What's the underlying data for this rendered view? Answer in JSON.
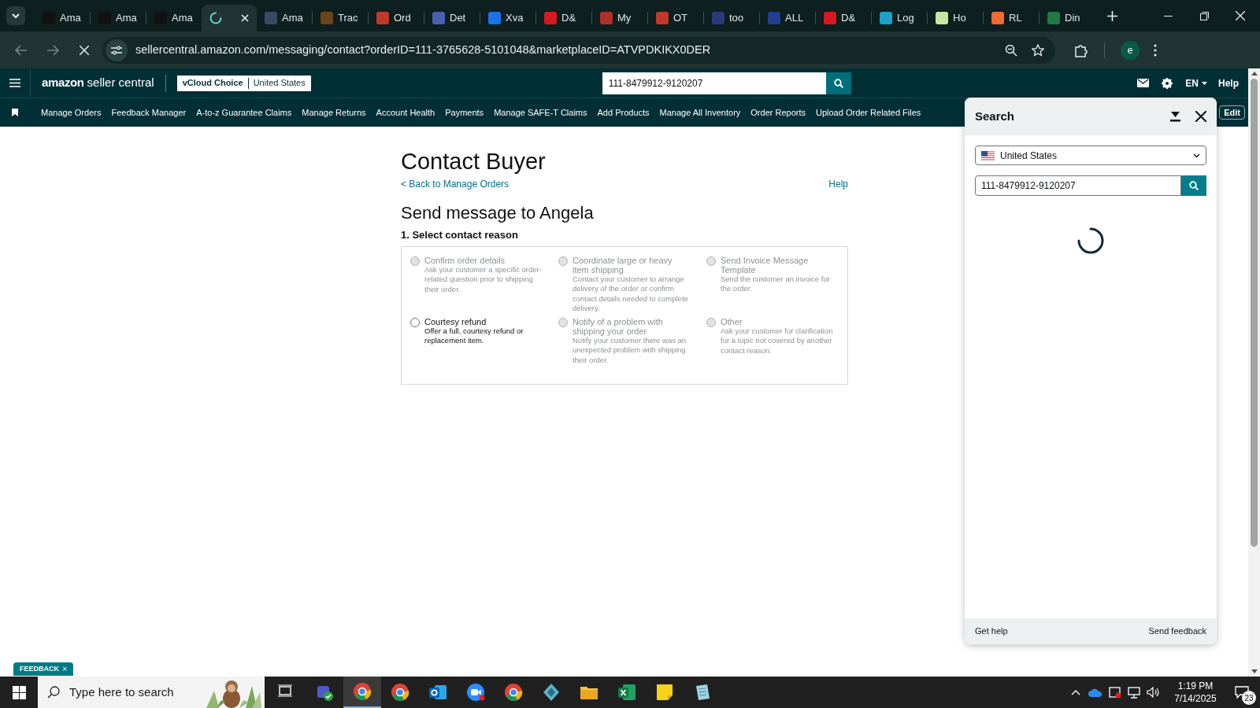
{
  "browser": {
    "tabs": [
      {
        "title": "Ama",
        "color": "#111111",
        "selected": false,
        "loading": false
      },
      {
        "title": "Ama",
        "color": "#111111",
        "selected": false,
        "loading": false
      },
      {
        "title": "Ama",
        "color": "#111111",
        "selected": false,
        "loading": false
      },
      {
        "selected": true,
        "loading": true
      },
      {
        "title": "Ama",
        "color": "#3a4a66",
        "selected": false,
        "loading": false
      },
      {
        "title": "Trac",
        "color": "#6b4418",
        "selected": false,
        "loading": false
      },
      {
        "title": "Ord",
        "color": "#c0392b",
        "selected": false,
        "loading": false
      },
      {
        "title": "Det",
        "color": "#4a5fb0",
        "selected": false,
        "loading": false
      },
      {
        "title": "Xva",
        "color": "#1a73e8",
        "selected": false,
        "loading": false
      },
      {
        "title": "D&",
        "color": "#d71920",
        "selected": false,
        "loading": false
      },
      {
        "title": "My",
        "color": "#b0302a",
        "selected": false,
        "loading": false
      },
      {
        "title": "OT",
        "color": "#c0392b",
        "selected": false,
        "loading": false
      },
      {
        "title": "too",
        "color": "#2a3a7a",
        "selected": false,
        "loading": false
      },
      {
        "title": "ALL",
        "color": "#1f3f8f",
        "selected": false,
        "loading": false
      },
      {
        "title": "D&",
        "color": "#d71920",
        "selected": false,
        "loading": false
      },
      {
        "title": "Log",
        "color": "#1ea0c8",
        "selected": false,
        "loading": false
      },
      {
        "title": "Ho",
        "color": "#c8e6a0",
        "selected": false,
        "loading": false
      },
      {
        "title": "RL",
        "color": "#f06a35",
        "selected": false,
        "loading": false
      },
      {
        "title": "Din",
        "color": "#1f7a45",
        "selected": false,
        "loading": false
      }
    ],
    "url": "sellercentral.amazon.com/messaging/contact?orderID=111-3765628-5101048&marketplaceID=ATVPDKIKX0DER",
    "profile": "e"
  },
  "header": {
    "logo_brand": "amazon",
    "logo_product": "seller central",
    "account": "vCloud Choice",
    "marketplace": "United States",
    "search_value": "111-8479912-9120207",
    "language": "EN",
    "help": "Help"
  },
  "nav": {
    "items": [
      "Manage Orders",
      "Feedback Manager",
      "A-to-z Guarantee Claims",
      "Manage Returns",
      "Account Health",
      "Payments",
      "Manage SAFE-T Claims",
      "Add Products",
      "Manage All Inventory",
      "Order Reports",
      "Upload Order Related Files"
    ],
    "edit": "Edit"
  },
  "contact": {
    "title": "Contact Buyer",
    "back_link": "< Back to Manage Orders",
    "help": "Help",
    "heading": "Send message to Angela",
    "step": "1. Select contact reason",
    "reasons": [
      {
        "title": "Confirm order details",
        "description": "Ask your customer a specific order-related question prior to shipping their order.",
        "disabled": true,
        "selected": false
      },
      {
        "title": "Coordinate large or heavy item shipping",
        "description": "Contact your customer to arrange delivery of the order or confirm contact details needed to complete delivery.",
        "disabled": true,
        "selected": false
      },
      {
        "title": "Send Invoice Message Template",
        "description": "Send the customer an invoice for the order.",
        "disabled": true,
        "selected": false
      },
      {
        "title": "Courtesy refund",
        "description": "Offer a full, courtesy refund or replacement item.",
        "disabled": false,
        "selected": false
      },
      {
        "title": "Notify of a problem with shipping your order",
        "description": "Notify your customer there was an unexpected problem with shipping their order.",
        "disabled": true,
        "selected": false
      },
      {
        "title": "Other",
        "description": "Ask your customer for clarification for a topic not covered by another contact reason.",
        "disabled": true,
        "selected": false
      }
    ]
  },
  "search_panel": {
    "title": "Search",
    "country": "United States",
    "search_value": "111-8479912-9120207",
    "loading": true,
    "get_help": "Get help",
    "send_feedback": "Send feedback"
  },
  "feedback_tab": {
    "label": "FEEDBACK",
    "close": "×"
  },
  "taskbar": {
    "search_placeholder": "Type here to search",
    "apps": [
      {
        "kind": "taskview",
        "selected": false
      },
      {
        "kind": "teams",
        "selected": false
      },
      {
        "kind": "chrome",
        "selected": true
      },
      {
        "kind": "chrome",
        "selected": false
      },
      {
        "kind": "outlook",
        "selected": false
      },
      {
        "kind": "zoom",
        "selected": false
      },
      {
        "kind": "chrome",
        "selected": false
      },
      {
        "kind": "gem",
        "selected": false
      },
      {
        "kind": "folder",
        "selected": false
      },
      {
        "kind": "excel",
        "selected": false
      },
      {
        "kind": "sticky",
        "selected": false
      },
      {
        "kind": "notes",
        "selected": false
      }
    ],
    "time": "1:19 PM",
    "date": "7/14/2025",
    "notifications": "23"
  }
}
